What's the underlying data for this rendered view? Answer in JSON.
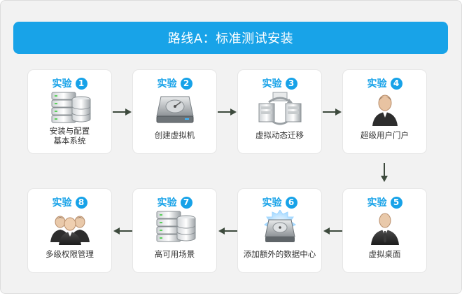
{
  "title": "路线A：标准测试安装",
  "colors": {
    "accent": "#18a3e8",
    "card_bg": "#ffffff",
    "page_bg": "#f2f2f2",
    "arrow": "#3d4a3d"
  },
  "steps": [
    {
      "heading": "实验",
      "number": "1",
      "label_lines": [
        "安装与配置",
        "基本系统"
      ],
      "icon": "database-server-icon"
    },
    {
      "heading": "实验",
      "number": "2",
      "label_lines": [
        "创建虚拟机"
      ],
      "icon": "hard-drive-icon"
    },
    {
      "heading": "实验",
      "number": "3",
      "label_lines": [
        "虚拟动态迁移"
      ],
      "icon": "migration-servers-icon"
    },
    {
      "heading": "实验",
      "number": "4",
      "label_lines": [
        "超级用户门户"
      ],
      "icon": "user-icon"
    },
    {
      "heading": "实验",
      "number": "5",
      "label_lines": [
        "虚拟桌面"
      ],
      "icon": "business-user-icon"
    },
    {
      "heading": "实验",
      "number": "6",
      "label_lines": [
        "添加额外的数据中心"
      ],
      "icon": "datacenter-disk-icon"
    },
    {
      "heading": "实验",
      "number": "7",
      "label_lines": [
        "高可用场景"
      ],
      "icon": "database-server-icon"
    },
    {
      "heading": "实验",
      "number": "8",
      "label_lines": [
        "多级权限管理"
      ],
      "icon": "user-group-icon"
    }
  ]
}
